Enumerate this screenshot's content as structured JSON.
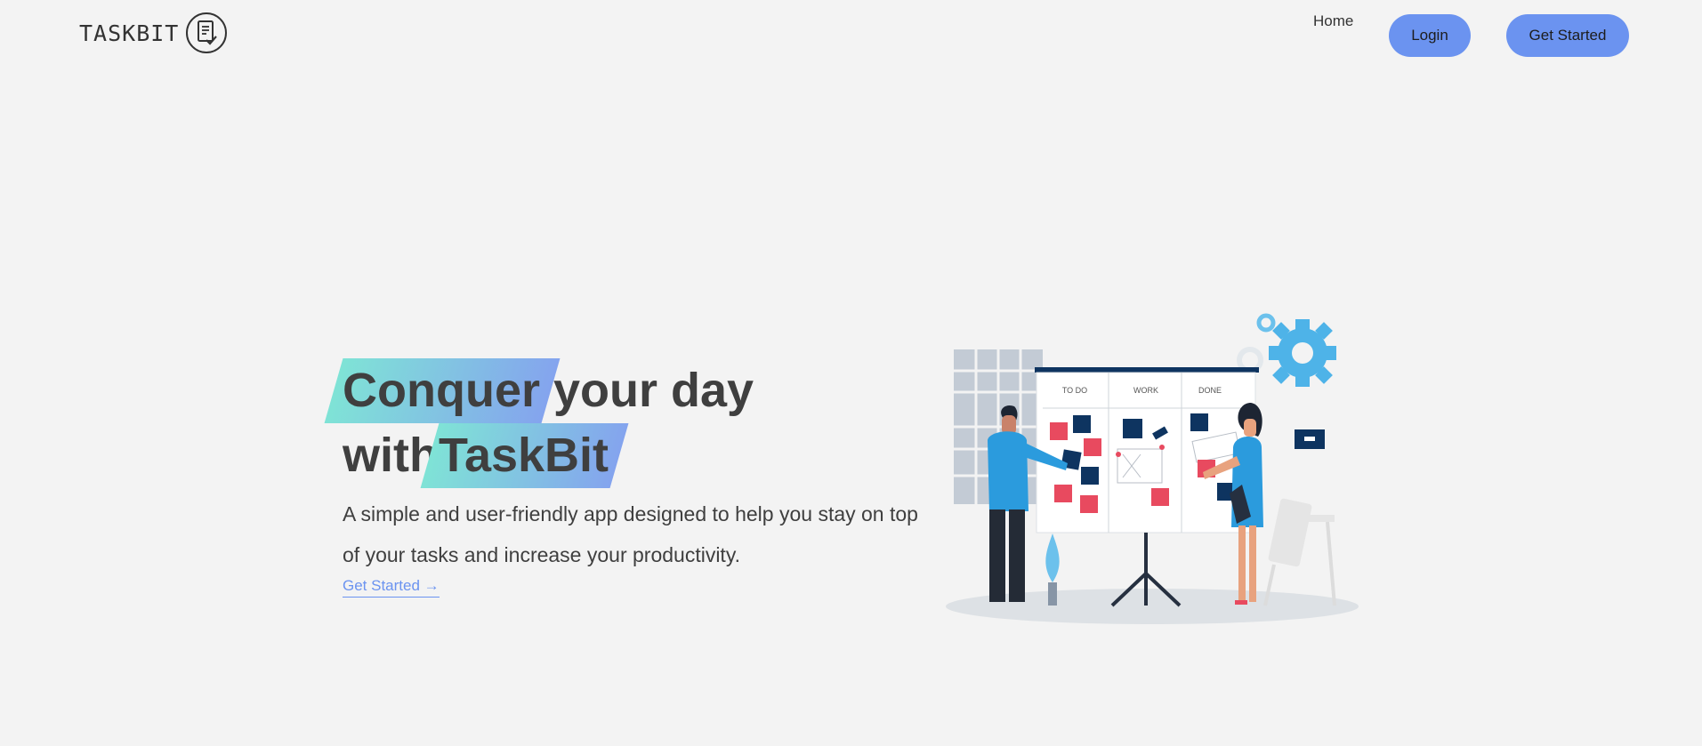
{
  "brand": {
    "name": "TASKBIT",
    "logo_icon": "document-check-icon"
  },
  "nav": {
    "home_label": "Home",
    "login_label": "Login",
    "get_started_label": "Get Started"
  },
  "hero": {
    "headline_highlight_1": "Conquer",
    "headline_rest_1": " your day",
    "headline_prefix_2": "with",
    "headline_highlight_2": "TaskBit",
    "subtitle": "A simple and user-friendly app designed to help you stay on top of your tasks and increase your productivity.",
    "cta_label": "Get Started →"
  },
  "illustration": {
    "board_columns": [
      "TO DO",
      "WORK",
      "DONE"
    ]
  },
  "colors": {
    "background": "#f3f3f3",
    "accent_blue": "#6b93f0",
    "highlight_start": "#7fe3d6",
    "highlight_end": "#84a4ee",
    "text": "#3f3f3f"
  }
}
